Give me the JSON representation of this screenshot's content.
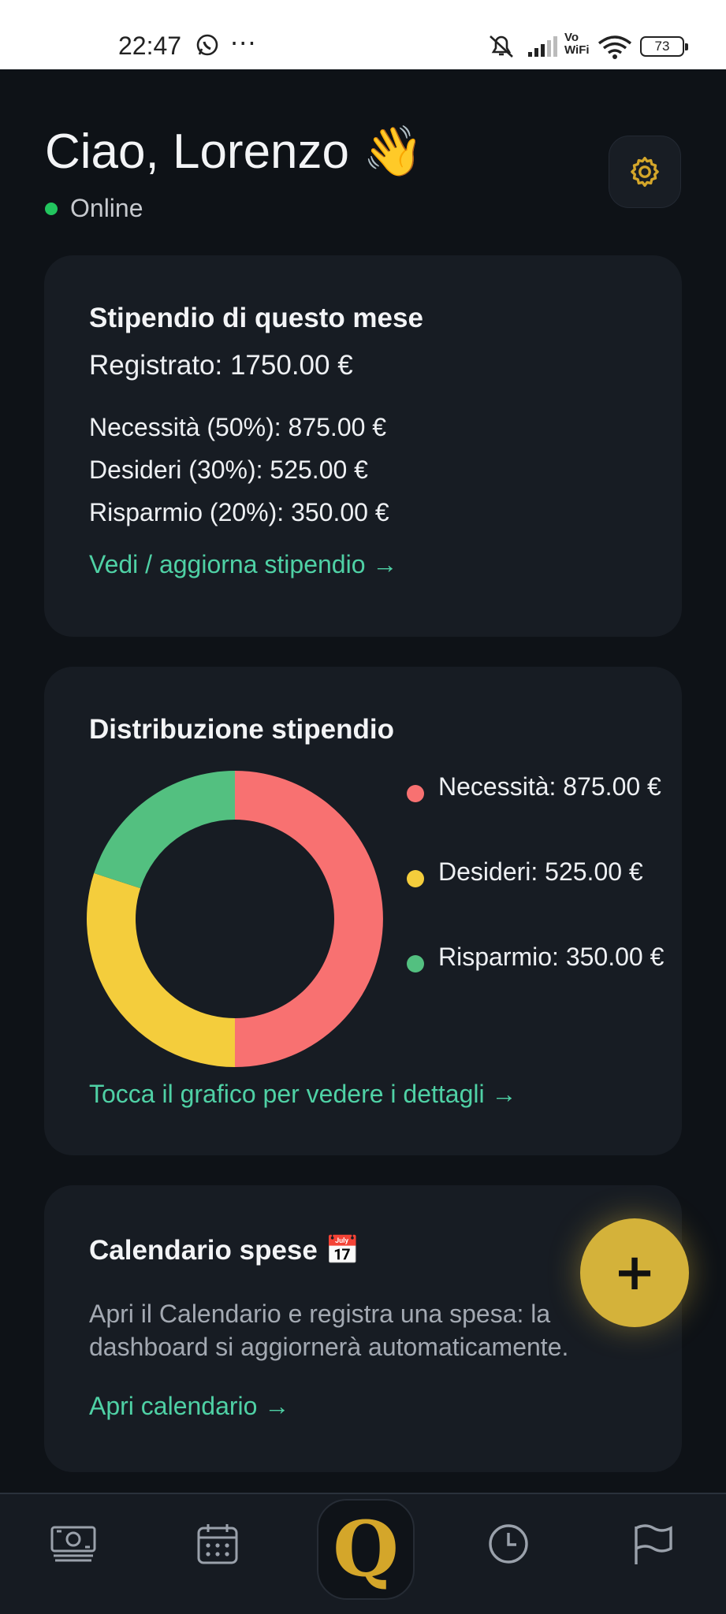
{
  "status_bar": {
    "time": "22:47",
    "more": "···",
    "vowifi": "Vo\nWiFi",
    "battery": "73",
    "icons": [
      "whatsapp-icon",
      "mute-icon",
      "signal-icon",
      "wifi-icon",
      "battery-icon"
    ]
  },
  "header": {
    "greeting": "Ciao, Lorenzo 👋",
    "status": "Online",
    "settings_icon": "gear-icon"
  },
  "salary_card": {
    "title": "Stipendio di questo mese",
    "registered": "Registrato: 1750.00 €",
    "needs": "Necessità (50%): 875.00 €",
    "wants": "Desideri (30%): 525.00 €",
    "savings": "Risparmio (20%): 350.00 €",
    "link": "Vedi / aggiorna stipendio →"
  },
  "distribution_card": {
    "title": "Distribuzione stipendio",
    "legend": [
      {
        "label": "Necessità: 875.00 €",
        "color": "#f87171"
      },
      {
        "label": "Desideri: 525.00 €",
        "color": "#f4cd3c"
      },
      {
        "label": "Risparmio: 350.00 €",
        "color": "#53c080"
      }
    ],
    "link": "Tocca il grafico per vedere i dettagli →"
  },
  "chart_data": {
    "type": "pie",
    "categories": [
      "Necessità",
      "Desideri",
      "Risparmio"
    ],
    "values": [
      875.0,
      525.0,
      350.0
    ],
    "colors": [
      "#f87171",
      "#f4cd3c",
      "#53c080"
    ],
    "donut": true
  },
  "calendar_card": {
    "title": "Calendario spese 📅",
    "description": "Apri il Calendario e registra una spesa: la dashboard si aggiornerà automaticamente.",
    "link": "Apri calendario →"
  },
  "fab": {
    "label": "+"
  },
  "bottom_nav": {
    "items": [
      "money-icon",
      "calendar-icon",
      "home-logo",
      "clock-icon",
      "flag-icon"
    ],
    "logo_letter": "Q"
  }
}
